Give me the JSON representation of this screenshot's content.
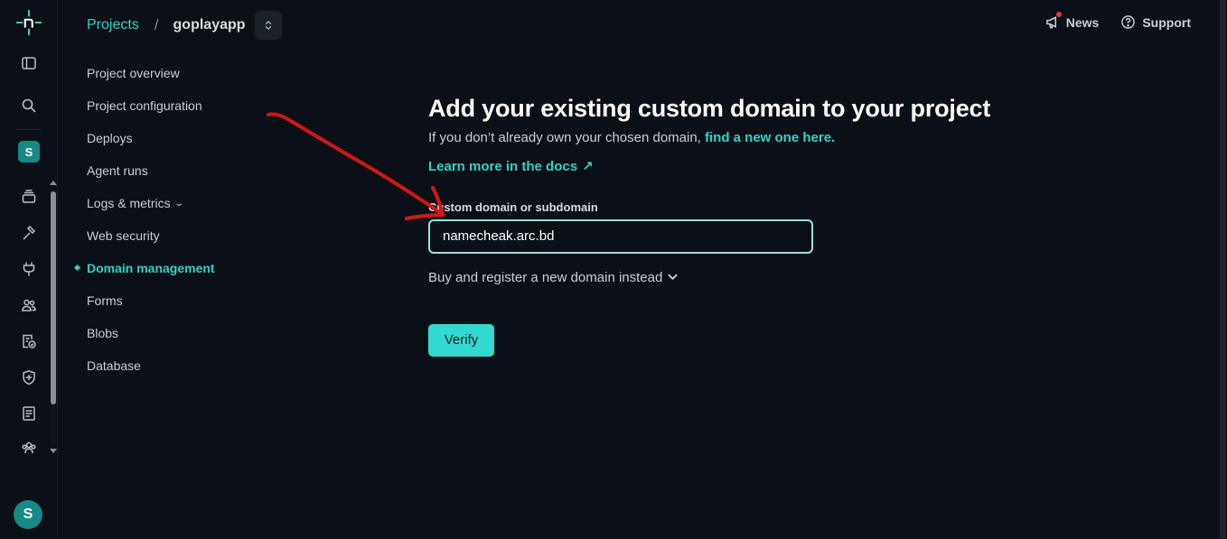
{
  "header": {
    "breadcrumb_projects": "Projects",
    "breadcrumb_separator": "/",
    "breadcrumb_site": "goplayapp",
    "news_label": "News",
    "support_label": "Support"
  },
  "rail": {
    "site_avatar": "S",
    "user_avatar": "S",
    "icons": [
      "netlify-logo-icon",
      "sidebar-toggle-icon",
      "search-icon",
      "layers-icon",
      "hammer-icon",
      "plug-icon",
      "team-icon",
      "document-badge-icon",
      "shield-icon",
      "receipt-icon",
      "gear-group-icon"
    ]
  },
  "subnav": {
    "items": [
      {
        "label": "Project overview"
      },
      {
        "label": "Project configuration"
      },
      {
        "label": "Deploys"
      },
      {
        "label": "Agent runs"
      },
      {
        "label": "Logs & metrics"
      },
      {
        "label": "Web security"
      },
      {
        "label": "Domain management"
      },
      {
        "label": "Forms"
      },
      {
        "label": "Blobs"
      },
      {
        "label": "Database"
      }
    ],
    "active": "Domain management"
  },
  "main": {
    "title": "Add your existing custom domain to your project",
    "intro_text": "If you don’t already own your chosen domain, ",
    "intro_link": "find a new one here.",
    "docs_link": "Learn more in the docs",
    "docs_arrow": "↗",
    "field_label": "Custom domain or subdomain",
    "field_value": "namecheak.arc.bd",
    "buy_toggle": "Buy and register a new domain instead",
    "verify_label": "Verify"
  },
  "colors": {
    "background": "#0b1016",
    "accent": "#32d0c8",
    "button": "#32d9d1",
    "annotation_arrow": "#d01818"
  }
}
